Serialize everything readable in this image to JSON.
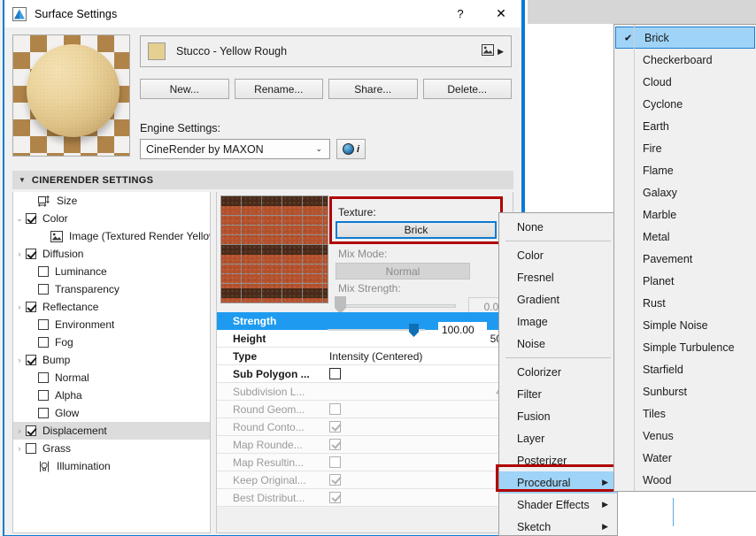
{
  "window": {
    "title": "Surface Settings",
    "icon": "archicad-app-icon",
    "help_button": "?",
    "close_button": "✕"
  },
  "top": {
    "preview_alt": "sphere-preview",
    "material_name": "Stucco - Yellow Rough",
    "material_swatch_color": "#e5cf91",
    "attach_icon": "image-link-icon",
    "expand_icon": "▶",
    "buttons": [
      "New...",
      "Rename...",
      "Share...",
      "Delete..."
    ],
    "engine_label": "Engine Settings:",
    "engine_value": "CineRender by MAXON",
    "engine_chevron": "⌄",
    "info_icon": "globe-icon",
    "info_letter": "i"
  },
  "section": {
    "caret": "▼",
    "title": "CINERENDER SETTINGS"
  },
  "tree": {
    "items": [
      {
        "label": "Size",
        "indent": 1,
        "arrow": "",
        "control": "icon",
        "icon": "size-icon",
        "checked": false,
        "selected": false
      },
      {
        "label": "Color",
        "indent": 0,
        "arrow": "⌄",
        "control": "checkbox",
        "checked": true,
        "selected": false
      },
      {
        "label": "Image (Textured Render Yellow G:",
        "indent": 2,
        "arrow": "",
        "control": "icon",
        "icon": "image-icon",
        "checked": false,
        "selected": false
      },
      {
        "label": "Diffusion",
        "indent": 0,
        "arrow": "›",
        "control": "checkbox",
        "checked": true,
        "selected": false
      },
      {
        "label": "Luminance",
        "indent": 1,
        "arrow": "",
        "control": "checkbox",
        "checked": false,
        "selected": false
      },
      {
        "label": "Transparency",
        "indent": 1,
        "arrow": "",
        "control": "checkbox",
        "checked": false,
        "selected": false
      },
      {
        "label": "Reflectance",
        "indent": 0,
        "arrow": "›",
        "control": "checkbox",
        "checked": true,
        "selected": false
      },
      {
        "label": "Environment",
        "indent": 1,
        "arrow": "",
        "control": "checkbox",
        "checked": false,
        "selected": false
      },
      {
        "label": "Fog",
        "indent": 1,
        "arrow": "",
        "control": "checkbox",
        "checked": false,
        "selected": false
      },
      {
        "label": "Bump",
        "indent": 0,
        "arrow": "›",
        "control": "checkbox",
        "checked": true,
        "selected": false
      },
      {
        "label": "Normal",
        "indent": 1,
        "arrow": "",
        "control": "checkbox",
        "checked": false,
        "selected": false
      },
      {
        "label": "Alpha",
        "indent": 1,
        "arrow": "",
        "control": "checkbox",
        "checked": false,
        "selected": false
      },
      {
        "label": "Glow",
        "indent": 1,
        "arrow": "",
        "control": "checkbox",
        "checked": false,
        "selected": false
      },
      {
        "label": "Displacement",
        "indent": 0,
        "arrow": "›",
        "control": "checkbox",
        "checked": true,
        "selected": true
      },
      {
        "label": "Grass",
        "indent": 0,
        "arrow": "›",
        "control": "checkbox",
        "checked": false,
        "selected": false
      },
      {
        "label": "Illumination",
        "indent": 1,
        "arrow": "",
        "control": "icon",
        "icon": "illumination-icon",
        "checked": false,
        "selected": false
      }
    ]
  },
  "properties": {
    "thumbnail_alt": "brick-texture-preview",
    "texture_label": "Texture:",
    "texture_value": "Brick",
    "mix_mode_label": "Mix Mode:",
    "mix_mode_value": "Normal",
    "mix_strength_label": "Mix Strength:",
    "mix_strength_value": "0.00",
    "rows": [
      {
        "name": "Strength",
        "value": "100.00",
        "kind": "slider",
        "highlight": true,
        "dim": false
      },
      {
        "name": "Height",
        "value": "50",
        "kind": "text",
        "highlight": false,
        "dim": false
      },
      {
        "name": "Type",
        "value": "Intensity (Centered)",
        "kind": "textleft",
        "highlight": false,
        "dim": false
      },
      {
        "name": "Sub Polygon ...",
        "value": "",
        "kind": "checkbox",
        "checked": false,
        "highlight": false,
        "dim": false
      },
      {
        "name": "Subdivision L...",
        "value": "4",
        "kind": "text",
        "highlight": false,
        "dim": true
      },
      {
        "name": "Round Geom...",
        "value": "",
        "kind": "checkbox",
        "checked": false,
        "highlight": false,
        "dim": true
      },
      {
        "name": "Round Conto...",
        "value": "",
        "kind": "checkbox",
        "checked": true,
        "highlight": false,
        "dim": true
      },
      {
        "name": "Map Rounde...",
        "value": "",
        "kind": "checkbox",
        "checked": true,
        "highlight": false,
        "dim": true
      },
      {
        "name": "Map Resultin...",
        "value": "",
        "kind": "checkbox",
        "checked": false,
        "highlight": false,
        "dim": true
      },
      {
        "name": "Keep Original...",
        "value": "",
        "kind": "checkbox",
        "checked": true,
        "highlight": false,
        "dim": true
      },
      {
        "name": "Best Distribut...",
        "value": "",
        "kind": "checkbox",
        "checked": true,
        "highlight": false,
        "dim": true
      }
    ]
  },
  "context_menu": {
    "items": [
      {
        "label": "None",
        "type": "item",
        "selected": false
      },
      {
        "label": "",
        "type": "separator",
        "selected": false
      },
      {
        "label": "Color",
        "type": "item",
        "selected": false
      },
      {
        "label": "Fresnel",
        "type": "item",
        "selected": false
      },
      {
        "label": "Gradient",
        "type": "item",
        "selected": false
      },
      {
        "label": "Image",
        "type": "item",
        "selected": false
      },
      {
        "label": "Noise",
        "type": "item",
        "selected": false
      },
      {
        "label": "",
        "type": "separator",
        "selected": false
      },
      {
        "label": "Colorizer",
        "type": "item",
        "selected": false
      },
      {
        "label": "Filter",
        "type": "item",
        "selected": false
      },
      {
        "label": "Fusion",
        "type": "item",
        "selected": false
      },
      {
        "label": "Layer",
        "type": "item",
        "selected": false
      },
      {
        "label": "Posterizer",
        "type": "item",
        "selected": false
      },
      {
        "label": "Procedural",
        "type": "submenu",
        "selected": true
      },
      {
        "label": "Shader Effects",
        "type": "submenu",
        "selected": false
      },
      {
        "label": "Sketch",
        "type": "submenu",
        "selected": false
      }
    ],
    "submenu_arrow": "▶"
  },
  "submenu": {
    "check_glyph": "✔",
    "items": [
      {
        "label": "Brick",
        "checked": true
      },
      {
        "label": "Checkerboard",
        "checked": false
      },
      {
        "label": "Cloud",
        "checked": false
      },
      {
        "label": "Cyclone",
        "checked": false
      },
      {
        "label": "Earth",
        "checked": false
      },
      {
        "label": "Fire",
        "checked": false
      },
      {
        "label": "Flame",
        "checked": false
      },
      {
        "label": "Galaxy",
        "checked": false
      },
      {
        "label": "Marble",
        "checked": false
      },
      {
        "label": "Metal",
        "checked": false
      },
      {
        "label": "Pavement",
        "checked": false
      },
      {
        "label": "Planet",
        "checked": false
      },
      {
        "label": "Rust",
        "checked": false
      },
      {
        "label": "Simple Noise",
        "checked": false
      },
      {
        "label": "Simple Turbulence",
        "checked": false
      },
      {
        "label": "Starfield",
        "checked": false
      },
      {
        "label": "Sunburst",
        "checked": false
      },
      {
        "label": "Tiles",
        "checked": false
      },
      {
        "label": "Venus",
        "checked": false
      },
      {
        "label": "Water",
        "checked": false
      },
      {
        "label": "Wood",
        "checked": false
      }
    ]
  },
  "colors": {
    "accent_blue": "#0a7bd4",
    "highlight_blue": "#1e9bf0",
    "menu_select": "#9fd3f7",
    "annotation_red": "#b00000"
  }
}
